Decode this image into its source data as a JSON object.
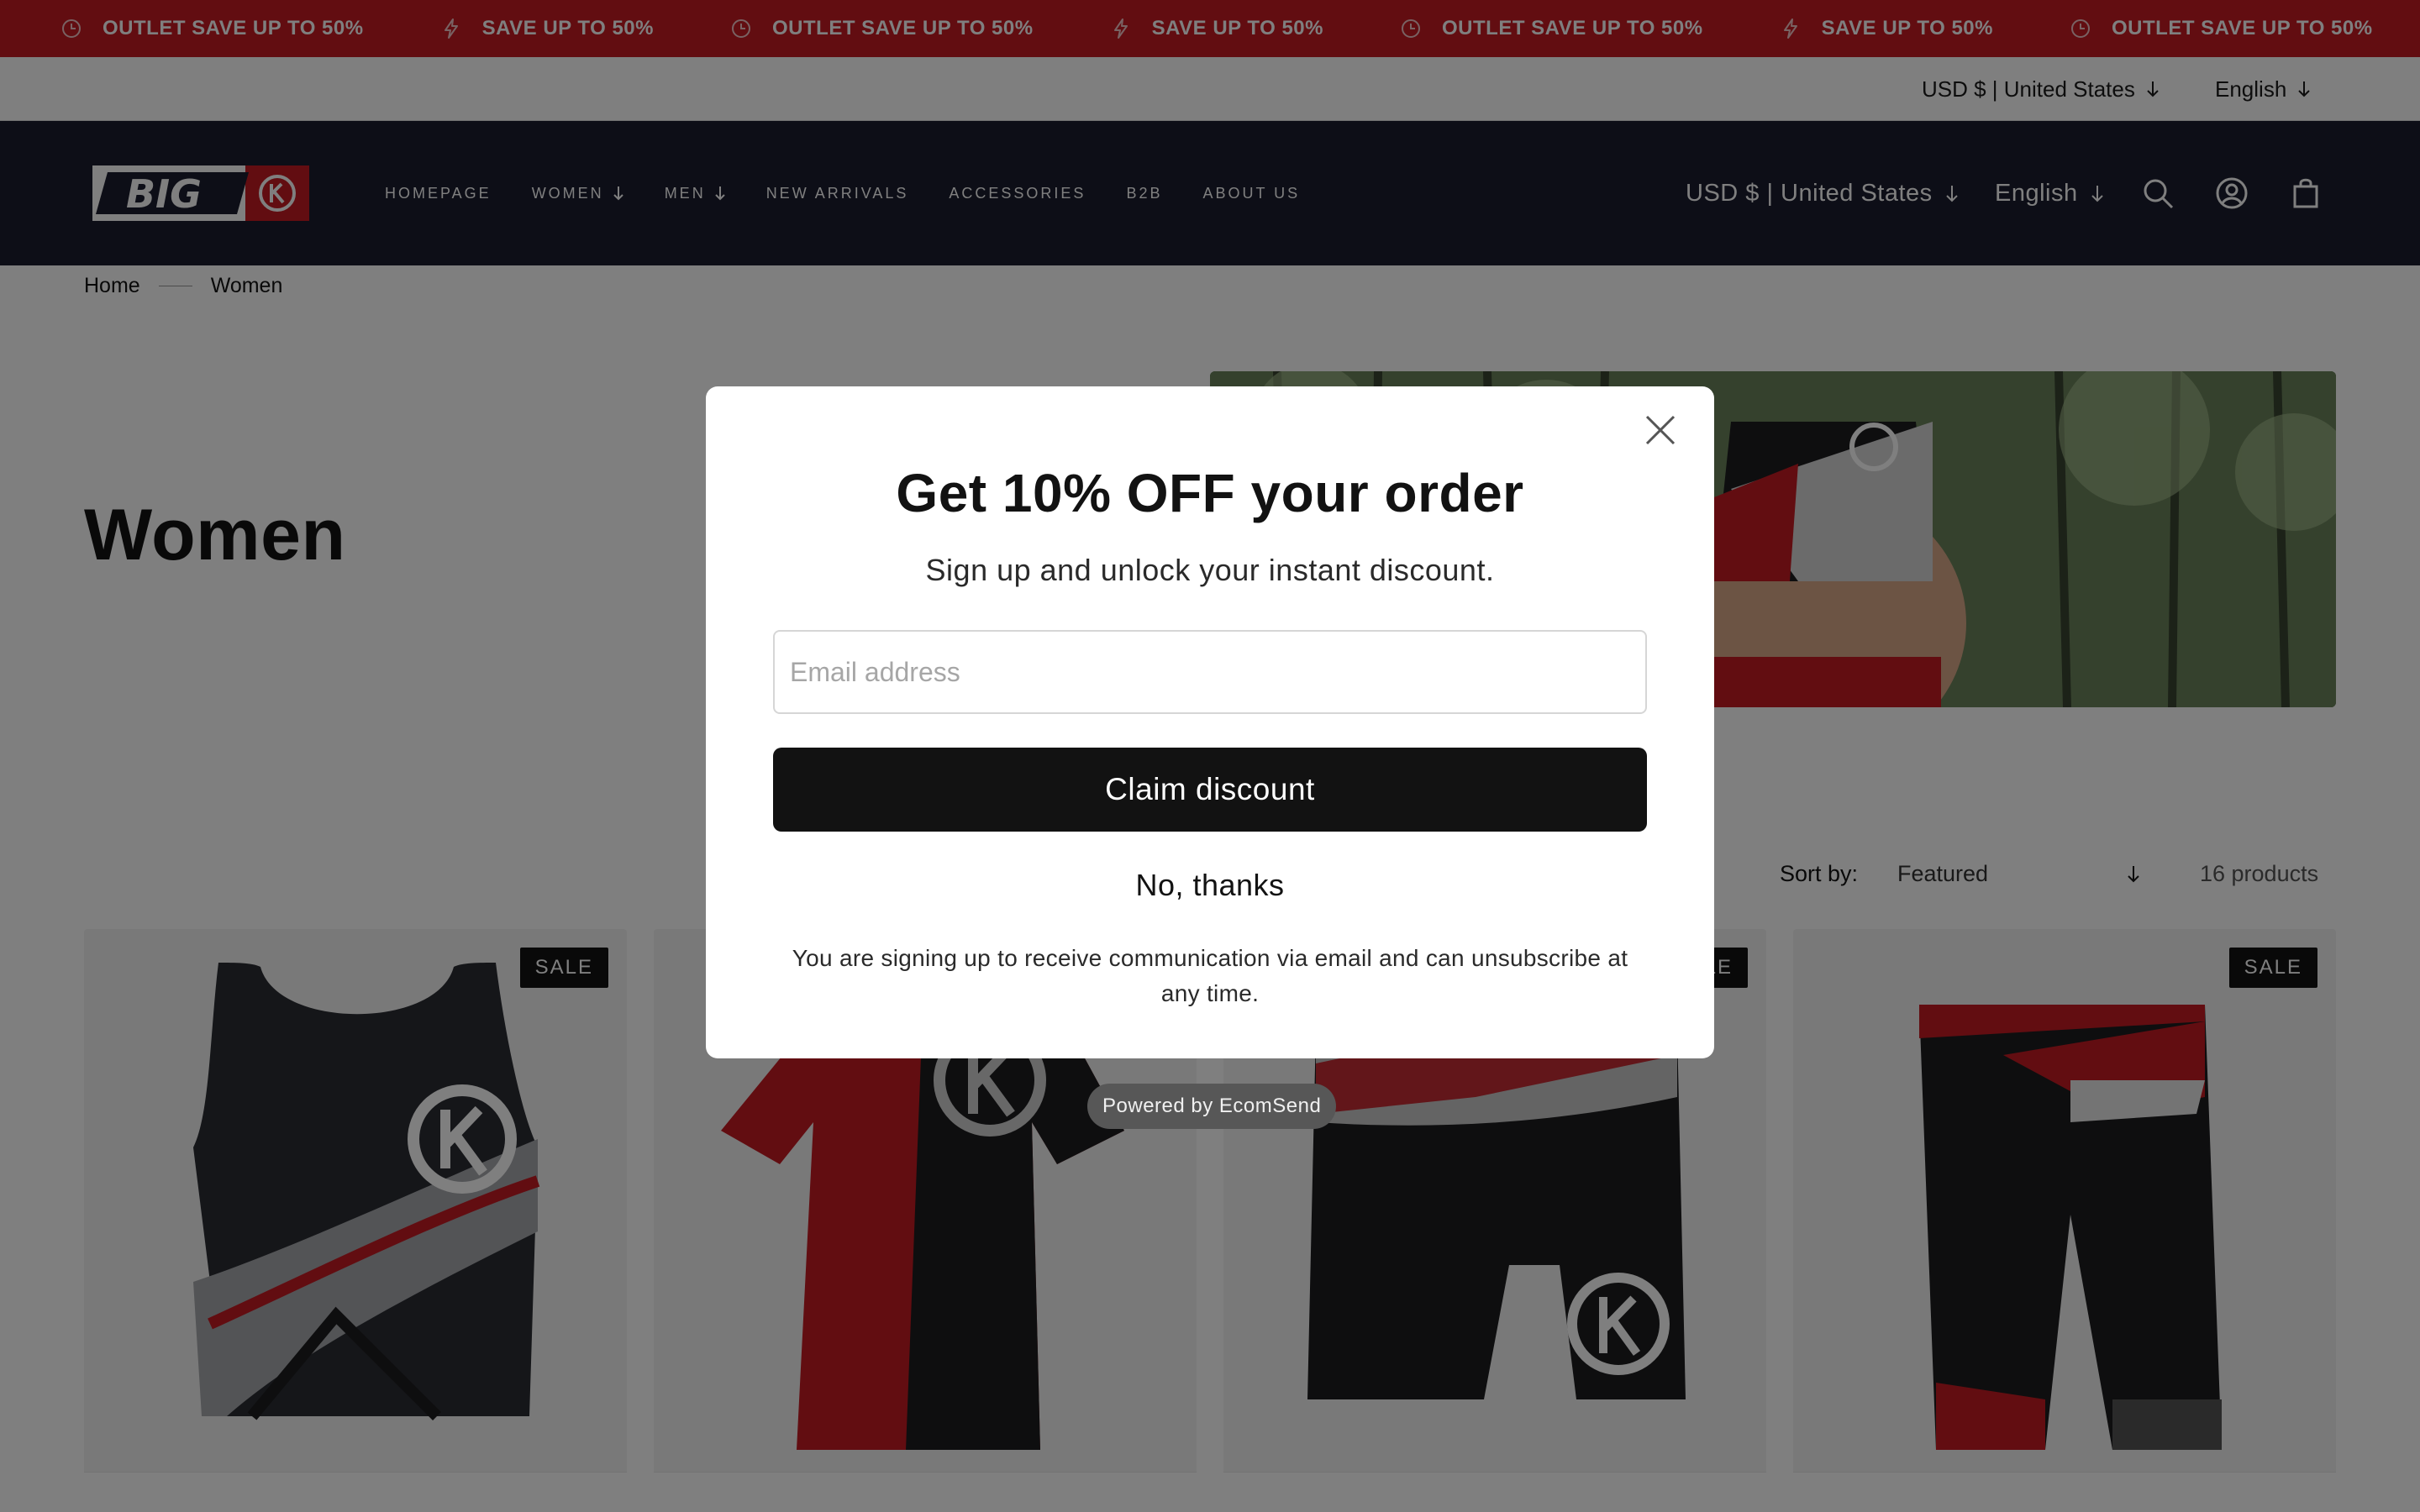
{
  "announcement": {
    "items": [
      {
        "icon": "clock-icon",
        "text": "OUTLET SAVE UP TO 50%"
      },
      {
        "icon": "lightning-icon",
        "text": "SAVE UP TO 50%"
      },
      {
        "icon": "clock-icon",
        "text": "OUTLET SAVE UP TO 50%"
      },
      {
        "icon": "lightning-icon",
        "text": "SAVE UP TO 50%"
      },
      {
        "icon": "clock-icon",
        "text": "OUTLET SAVE UP TO 50%"
      },
      {
        "icon": "lightning-icon",
        "text": "SAVE UP TO 50%"
      },
      {
        "icon": "clock-icon",
        "text": "OUTLET SAVE UP TO 50%"
      }
    ],
    "background": "#c41b23"
  },
  "utility": {
    "currency": "USD $ | United States",
    "language": "English"
  },
  "header": {
    "logo_text": "BIG",
    "nav": [
      {
        "label": "HOMEPAGE",
        "dropdown": false
      },
      {
        "label": "WOMEN",
        "dropdown": true
      },
      {
        "label": "MEN",
        "dropdown": true
      },
      {
        "label": "NEW ARRIVALS",
        "dropdown": false
      },
      {
        "label": "ACCESSORIES",
        "dropdown": false
      },
      {
        "label": "B2B",
        "dropdown": false
      },
      {
        "label": "ABOUT US",
        "dropdown": false
      }
    ],
    "currency": "USD $ | United States",
    "language": "English",
    "icons": [
      "search-icon",
      "account-icon",
      "cart-icon"
    ],
    "background": "#1b1c2e"
  },
  "breadcrumb": {
    "items": [
      "Home",
      "Women"
    ]
  },
  "page": {
    "title": "Women"
  },
  "toolbar": {
    "sort_label": "Sort by:",
    "sort_value": "Featured",
    "product_count": "16 products"
  },
  "products": [
    {
      "badge": "SALE",
      "type": "crop-top"
    },
    {
      "badge": "",
      "type": "tshirt"
    },
    {
      "badge": "SALE",
      "type": "shorts"
    },
    {
      "badge": "SALE",
      "type": "tri-shorts"
    }
  ],
  "modal": {
    "title": "Get 10% OFF your order",
    "subtitle": "Sign up and unlock your instant discount.",
    "email_placeholder": "Email address",
    "email_value": "",
    "claim_label": "Claim discount",
    "decline_label": "No, thanks",
    "disclaimer": "You are signing up to receive communication via email and can unsubscribe at any time.",
    "powered_by": "Powered by EcomSend"
  }
}
